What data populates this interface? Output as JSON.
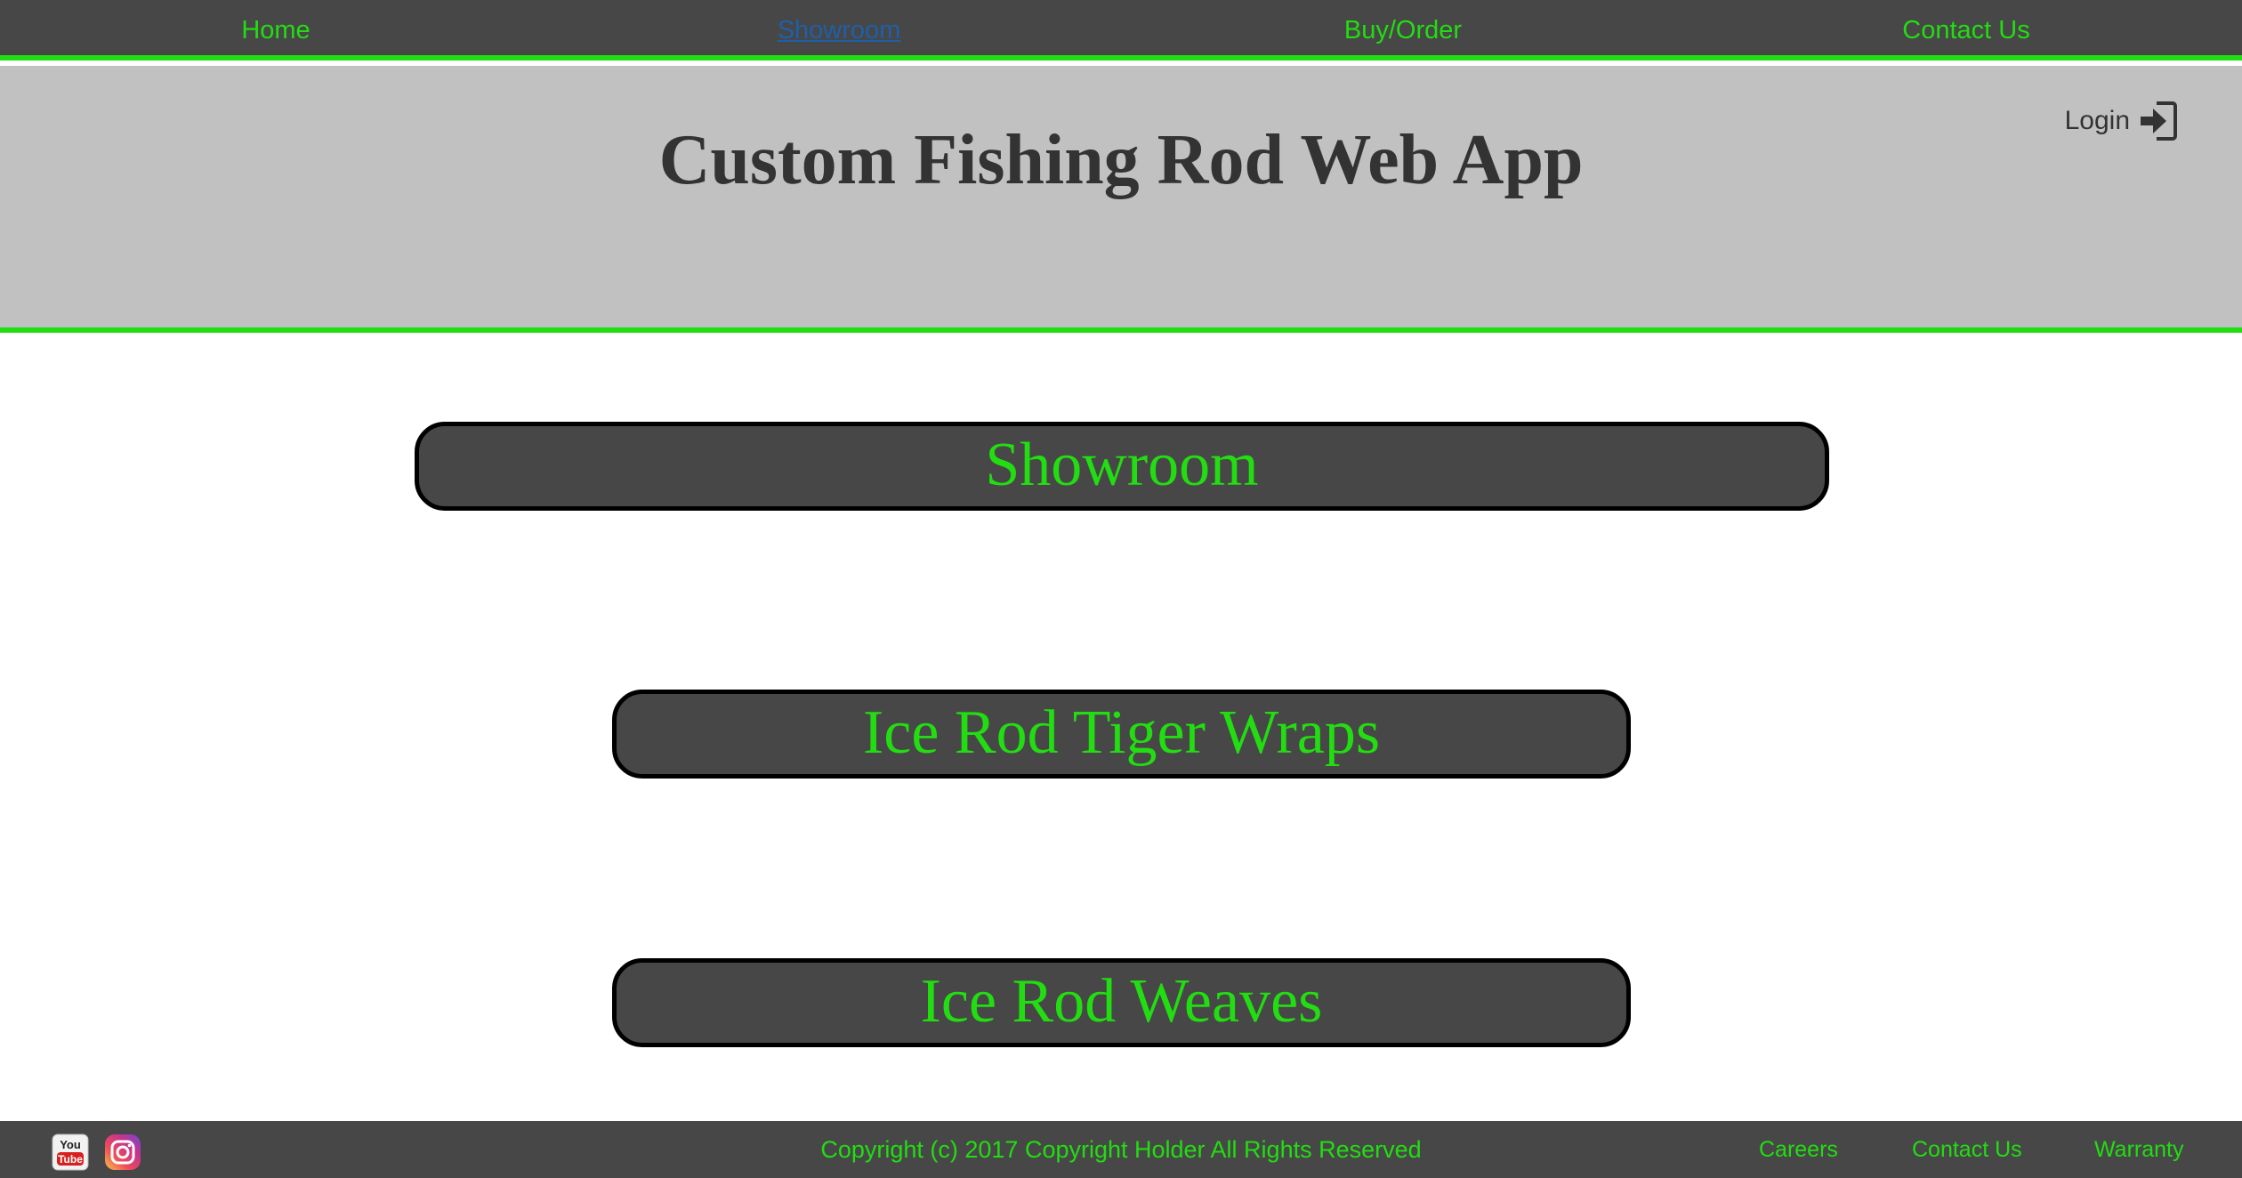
{
  "colors": {
    "accent": "#22dd11",
    "nav_bg": "#474747",
    "banner_bg": "#c1c1c1",
    "active_link": "#1f5fa8"
  },
  "nav": {
    "items": [
      {
        "label": "Home"
      },
      {
        "label": "Showroom",
        "active": true
      },
      {
        "label": "Buy/Order"
      },
      {
        "label": "Contact Us"
      }
    ]
  },
  "header": {
    "title": "Custom Fishing Rod Web App",
    "login_label": "Login",
    "login_icon": "sign-in-icon"
  },
  "main": {
    "buttons": [
      {
        "label": "Showroom"
      },
      {
        "label": "Ice Rod Tiger Wraps"
      },
      {
        "label": "Ice Rod Weaves"
      }
    ]
  },
  "footer": {
    "social": [
      {
        "icon": "youtube-icon",
        "text": "You Tube"
      },
      {
        "icon": "instagram-icon"
      }
    ],
    "copyright": "Copyright (c) 2017 Copyright Holder All Rights Reserved",
    "links": [
      {
        "label": "Careers"
      },
      {
        "label": "Contact Us"
      },
      {
        "label": "Warranty"
      }
    ]
  }
}
